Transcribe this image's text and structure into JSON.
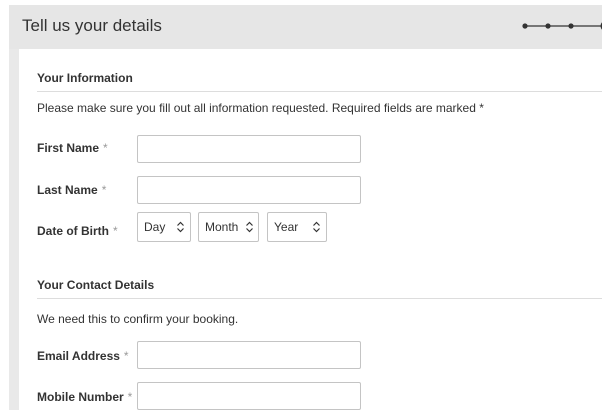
{
  "header": {
    "title": "Tell us your details",
    "progress_steps": 4,
    "progress_current": 4
  },
  "your_information": {
    "title": "Your Information",
    "description": "Please make sure you fill out all information requested. Required fields are marked *",
    "first_name": {
      "label": "First Name",
      "required_mark": "*",
      "value": ""
    },
    "last_name": {
      "label": "Last Name",
      "required_mark": "*",
      "value": ""
    },
    "dob": {
      "label": "Date of Birth",
      "required_mark": "*",
      "day": "Day",
      "month": "Month",
      "year": "Year"
    }
  },
  "contact_details": {
    "title": "Your Contact Details",
    "description": "We need this to confirm your booking.",
    "email": {
      "label": "Email Address",
      "required_mark": "*",
      "value": ""
    },
    "mobile": {
      "label": "Mobile Number",
      "required_mark": "*",
      "value": ""
    }
  },
  "colors": {
    "panel_bg": "#e9e9e9",
    "card_bg": "#ffffff",
    "border": "#c4c4c4",
    "text": "#333333",
    "required": "#999999"
  },
  "icons": {
    "select_chevron": "chevron-up-down-icon",
    "progress": "progress-dots-icon"
  }
}
